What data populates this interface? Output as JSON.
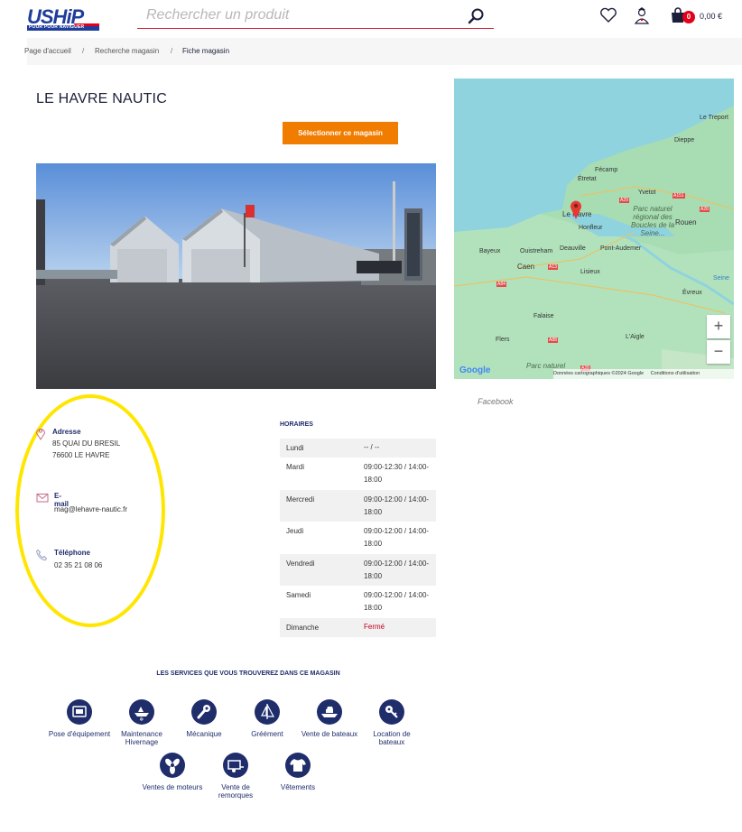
{
  "header": {
    "logo_text": "USHiP",
    "logo_tagline": "POUR POUR NAVIGUER",
    "search_placeholder": "Rechercher un produit",
    "cart_count": "0",
    "cart_total": "0,00 €"
  },
  "breadcrumb": {
    "items": [
      "Page d'accueil",
      "Recherche magasin",
      "Fiche magasin"
    ],
    "separator": "/"
  },
  "store": {
    "title": "LE HAVRE NAUTIC",
    "select_button": "Sélectionner ce magasin",
    "facebook_link": "Facebook"
  },
  "contact": {
    "address_title": "Adresse",
    "address_line1": "85 QUAI DU BRESIL",
    "address_line2": "76600 LE HAVRE",
    "email_title": "E-mail",
    "email": "mag@lehavre-nautic.fr",
    "phone_title": "Téléphone",
    "phone": "02 35 21 08 06"
  },
  "hours": {
    "title": "HORAIRES",
    "rows": [
      {
        "day": "Lundi",
        "time": "-- / --"
      },
      {
        "day": "Mardi",
        "time": "09:00-12:30 / 14:00-18:00"
      },
      {
        "day": "Mercredi",
        "time": "09:00-12:00 / 14:00-18:00"
      },
      {
        "day": "Jeudi",
        "time": "09:00-12:00 / 14:00-18:00"
      },
      {
        "day": "Vendredi",
        "time": "09:00-12:00 / 14:00-18:00"
      },
      {
        "day": "Samedi",
        "time": "09:00-12:00 / 14:00-18:00"
      },
      {
        "day": "Dimanche",
        "time": "Fermé"
      }
    ]
  },
  "map": {
    "labels": {
      "le_treport": "Le Treport",
      "dieppe": "Dieppe",
      "fecamp": "Fécamp",
      "etretat": "Étretat",
      "yvetot": "Yvetot",
      "le_havre": "Le Havre",
      "honfleur": "Honfleur",
      "rouen": "Rouen",
      "park1": "Parc naturel régional des Boucles de la Seine...",
      "bayeux": "Bayeux",
      "ouistreham": "Ouistreham",
      "deauville": "Deauville",
      "pont_audemer": "Pont-Audemer",
      "caen": "Caen",
      "lisieux": "Lisieux",
      "evreux": "Évreux",
      "falaise": "Falaise",
      "flers": "Flers",
      "laigle": "L'Aigle",
      "park2": "Parc naturel",
      "seine": "Seine",
      "a29": "A29",
      "a151": "A151",
      "a28": "A28",
      "a13": "A13",
      "a84": "A84",
      "a88": "A88",
      "a28b": "A28"
    },
    "zoom_in": "+",
    "zoom_out": "−",
    "google": "Google",
    "footer_data": "Données cartographiques ©2024 Google",
    "footer_terms": "Conditions d'utilisation"
  },
  "services": {
    "title": "LES SERVICES QUE VOUS TROUVEREZ DANS CE MAGASIN",
    "items": [
      {
        "label": "Pose d'équipement",
        "icon": "equipment-icon"
      },
      {
        "label": "Maintenance Hivernage",
        "icon": "winter-boat-icon"
      },
      {
        "label": "Mécanique",
        "icon": "wrench-icon"
      },
      {
        "label": "Gréément",
        "icon": "sail-icon"
      },
      {
        "label": "Vente de bateaux",
        "icon": "boat-sale-icon"
      },
      {
        "label": "Location de bateaux",
        "icon": "key-icon"
      },
      {
        "label": "Ventes de moteurs",
        "icon": "propeller-icon"
      },
      {
        "label": "Vente de remorques",
        "icon": "trailer-icon"
      },
      {
        "label": "Vêtements",
        "icon": "tshirt-icon"
      }
    ]
  },
  "colors": {
    "brand_blue": "#1f3d9a",
    "navy": "#1f2d6b",
    "orange": "#f07c00",
    "highlight_yellow": "#ffe600",
    "red": "#e2001a"
  }
}
